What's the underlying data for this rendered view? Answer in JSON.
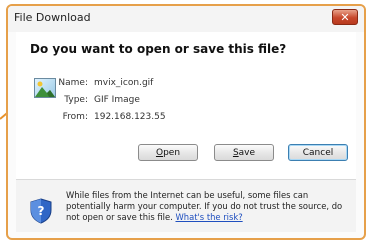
{
  "window": {
    "title": "File Download",
    "close_symbol": "✕"
  },
  "dialog": {
    "question": "Do you want to open or save this file?",
    "file_icon": "gif-image-icon",
    "fields": [
      {
        "label": "Name:",
        "value": "mvix_icon.gif"
      },
      {
        "label": "Type:",
        "value": "GIF Image"
      },
      {
        "label": "From:",
        "value": "192.168.123.55"
      }
    ],
    "buttons": {
      "open": {
        "accel": "O",
        "rest": "pen"
      },
      "save": {
        "accel": "S",
        "rest": "ave"
      },
      "cancel": "Cancel"
    }
  },
  "footer": {
    "icon": "shield-question-icon",
    "warning": "While files from the Internet can be useful, some files can potentially harm your computer. If you do not trust the source, do not open or save this file.",
    "risk_link": "What's the risk?"
  },
  "colors": {
    "frame_accent": "#e6a04a",
    "close_button": "#c8482c",
    "link": "#1f4fbf"
  }
}
